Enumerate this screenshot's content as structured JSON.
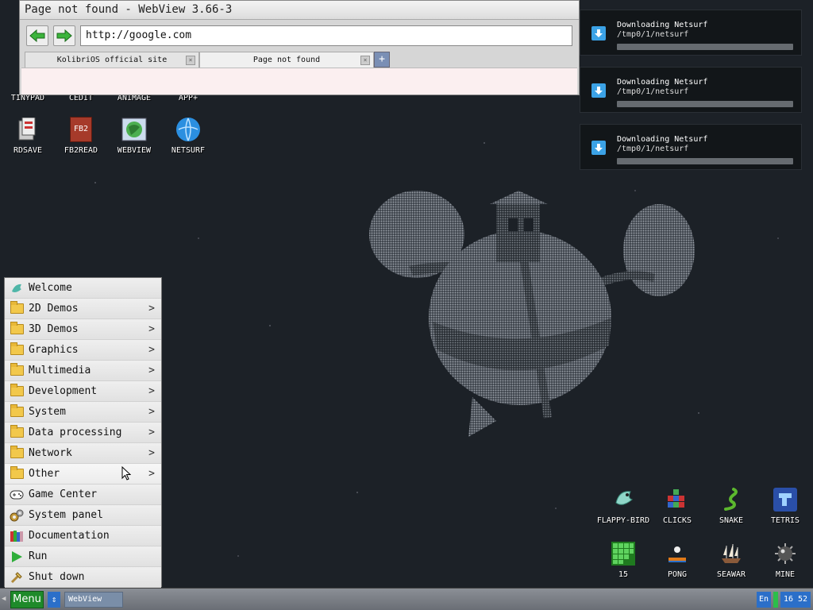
{
  "webview": {
    "title": "Page not found - WebView 3.66-3",
    "url": "http://google.com",
    "tabs": [
      {
        "label": "KolibriOS official site",
        "close": "×"
      },
      {
        "label": "Page not found",
        "close": "×"
      }
    ],
    "add_tab": "+"
  },
  "desktop_icons_top": [
    {
      "label": "TINYPAD"
    },
    {
      "label": "CEDIT"
    },
    {
      "label": "ANIMAGE"
    },
    {
      "label": "APP+"
    }
  ],
  "desktop_icons_row2": [
    {
      "label": "RDSAVE",
      "icon": "rdsave-icon"
    },
    {
      "label": "FB2READ",
      "icon": "fb2read-icon",
      "badge": "FB2"
    },
    {
      "label": "WEBVIEW",
      "icon": "webview-icon"
    },
    {
      "label": "NETSURF",
      "icon": "netsurf-icon"
    }
  ],
  "notifications": [
    {
      "title": "Downloading Netsurf",
      "path": "/tmp0/1/netsurf"
    },
    {
      "title": "Downloading Netsurf",
      "path": "/tmp0/1/netsurf"
    },
    {
      "title": "Downloading Netsurf",
      "path": "/tmp0/1/netsurf"
    }
  ],
  "menu": {
    "items": [
      {
        "label": "Welcome",
        "icon": "bird-icon",
        "submenu": false
      },
      {
        "label": "2D Demos",
        "icon": "folder-icon",
        "submenu": true
      },
      {
        "label": "3D Demos",
        "icon": "folder-icon",
        "submenu": true
      },
      {
        "label": "Graphics",
        "icon": "folder-icon",
        "submenu": true
      },
      {
        "label": "Multimedia",
        "icon": "folder-icon",
        "submenu": true
      },
      {
        "label": "Development",
        "icon": "folder-icon",
        "submenu": true
      },
      {
        "label": "System",
        "icon": "folder-icon",
        "submenu": true
      },
      {
        "label": "Data processing",
        "icon": "folder-icon",
        "submenu": true
      },
      {
        "label": "Network",
        "icon": "folder-icon",
        "submenu": true
      },
      {
        "label": "Other",
        "icon": "folder-icon",
        "submenu": true
      },
      {
        "label": "Game Center",
        "icon": "gamepad-icon",
        "submenu": false
      },
      {
        "label": "System panel",
        "icon": "gears-icon",
        "submenu": false
      },
      {
        "label": "Documentation",
        "icon": "books-icon",
        "submenu": false
      },
      {
        "label": "Run",
        "icon": "play-icon",
        "submenu": false
      },
      {
        "label": "Shut down",
        "icon": "shutdown-icon",
        "submenu": false
      }
    ],
    "arrow": ">"
  },
  "games": [
    {
      "label": "FLAPPY-BIRD"
    },
    {
      "label": "CLICKS"
    },
    {
      "label": "SNAKE"
    },
    {
      "label": "TETRIS"
    },
    {
      "label": "15"
    },
    {
      "label": "PONG"
    },
    {
      "label": "SEAWAR"
    },
    {
      "label": "MINE"
    }
  ],
  "taskbar": {
    "menu_label": "Menu",
    "switch": "⇕",
    "task": "WebView",
    "lang": "En",
    "clock": "16 52"
  }
}
